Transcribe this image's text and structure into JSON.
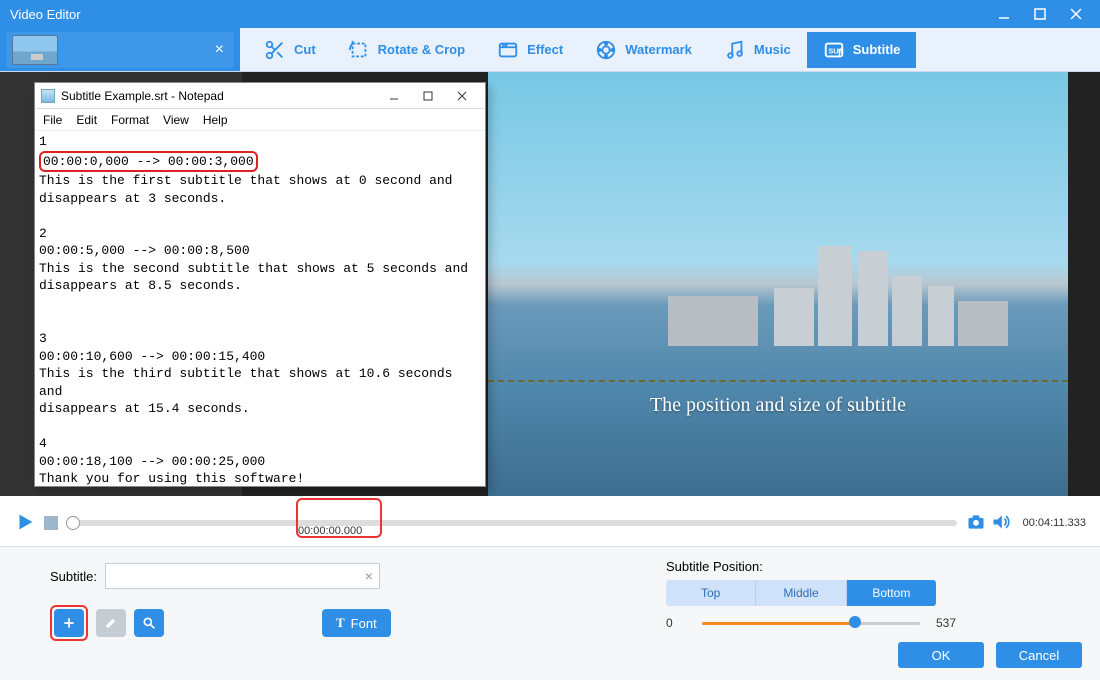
{
  "app_title": "Video Editor",
  "clip": {
    "name": " ",
    "close": "×"
  },
  "tabs": [
    {
      "id": "cut",
      "label": "Cut"
    },
    {
      "id": "rotate",
      "label": "Rotate & Crop"
    },
    {
      "id": "effect",
      "label": "Effect"
    },
    {
      "id": "watermark",
      "label": "Watermark"
    },
    {
      "id": "music",
      "label": "Music"
    },
    {
      "id": "subtitle",
      "label": "Subtitle",
      "active": true
    }
  ],
  "preview": {
    "subtitle_sample": "The position and size of subtitle"
  },
  "playback": {
    "position": "00:00:00.000",
    "duration": "00:04:11.333"
  },
  "subtitle_panel": {
    "label": "Subtitle:",
    "input_value": "",
    "font_button": "Font",
    "position_label": "Subtitle Position:",
    "positions": {
      "top": "Top",
      "middle": "Middle",
      "bottom": "Bottom",
      "selected": "bottom"
    },
    "slider": {
      "min": "0",
      "max": "537",
      "value_pct": 70
    }
  },
  "dialog": {
    "ok": "OK",
    "cancel": "Cancel"
  },
  "notepad": {
    "title": "Subtitle Example.srt - Notepad",
    "menu": {
      "file": "File",
      "edit": "Edit",
      "format": "Format",
      "view": "View",
      "help": "Help"
    },
    "body_pre": "1\n",
    "boxed": "00:00:0,000 --> 00:00:3,000",
    "body_post": "\nThis is the first subtitle that shows at 0 second and\ndisappears at 3 seconds.\n\n2\n00:00:5,000 --> 00:00:8,500\nThis is the second subtitle that shows at 5 seconds and\ndisappears at 8.5 seconds.\n\n\n3\n00:00:10,600 --> 00:00:15,400\nThis is the third subtitle that shows at 10.6 seconds\nand\ndisappears at 15.4 seconds.\n\n4\n00:00:18,100 --> 00:00:25,000\nThank you for using this software!"
  }
}
